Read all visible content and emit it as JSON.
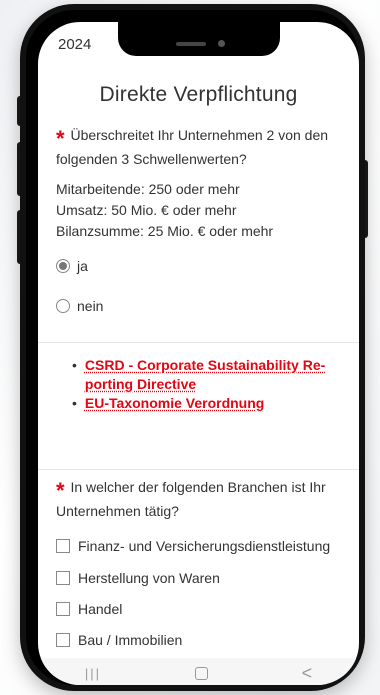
{
  "status": {
    "year": "2024"
  },
  "page": {
    "title": "Direkte Verpflichtung"
  },
  "question1": {
    "required_mark": "*",
    "text": "Überschreitet Ihr Unternehmen 2 von den folgenden 3 Schwellenwerten?",
    "thresholds": [
      "Mitarbeitende: 250 oder mehr",
      "Umsatz: 50 Mio. € oder mehr",
      "Bilanzsumme: 25 Mio. € oder mehr"
    ],
    "options": [
      {
        "label": "ja",
        "selected": true
      },
      {
        "label": "nein",
        "selected": false
      }
    ]
  },
  "links": [
    "CSRD - Corporate Sustainability Re-porting Directive",
    "EU-Taxonomie Verordnung"
  ],
  "question2": {
    "required_mark": "*",
    "text": "In welcher der folgenden Branchen ist Ihr Unternehmen tätig?",
    "options": [
      "Finanz- und Versicherungsdienstleistung",
      "Herstellung von Waren",
      "Handel",
      "Bau / Immobilien"
    ]
  },
  "navbar": {
    "recent": "|||",
    "back": "<"
  },
  "colors": {
    "accent": "#e30613",
    "text": "#333333"
  }
}
